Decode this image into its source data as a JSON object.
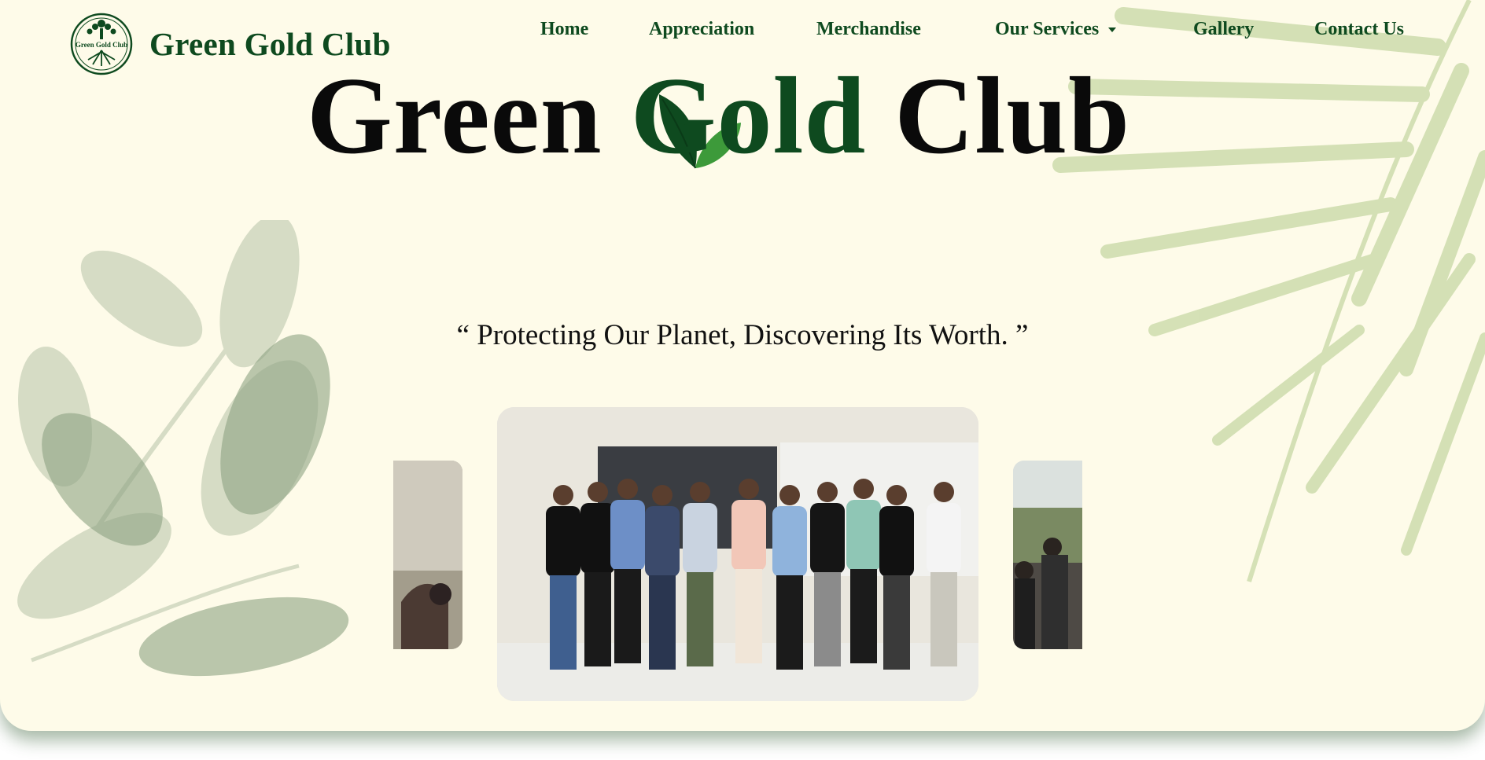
{
  "brand": {
    "name": "Green Gold Club",
    "logo_text": "Green Gold Club"
  },
  "nav": {
    "items": [
      {
        "label": "Home"
      },
      {
        "label": "Appreciation"
      },
      {
        "label": "Merchandise"
      },
      {
        "label": "Our Services"
      },
      {
        "label": "Gallery"
      },
      {
        "label": "Contact Us"
      }
    ]
  },
  "hero": {
    "title_part1": "Green",
    "title_part2": "Gold",
    "title_part3": "Club",
    "tagline": "“ Protecting Our Planet, Discovering Its Worth. ”"
  },
  "carousel": {
    "main_alt": "Group photo of club members",
    "prev_alt": "Previous gallery photo",
    "next_alt": "Next gallery photo"
  },
  "colors": {
    "brand_green": "#0e4a1f",
    "leaf_light": "#3d9a3a",
    "background": "#fefbe9"
  },
  "icons": {
    "logo": "tree-emblem-icon",
    "dropdown": "caret-down-icon",
    "accent": "leaf-icon"
  }
}
